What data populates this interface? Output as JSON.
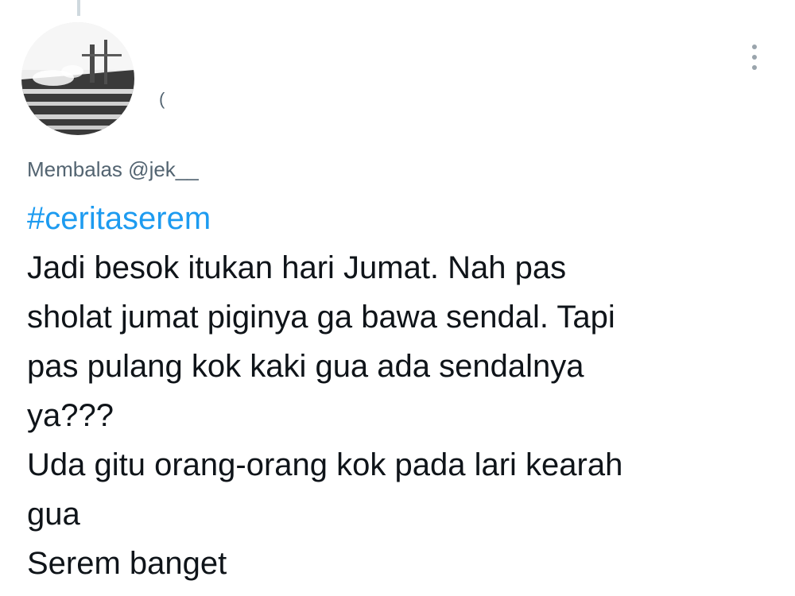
{
  "tweet": {
    "author_name_partial": "(",
    "reply_prefix": "Membalas",
    "reply_handle": "@jek__",
    "hashtag": "#ceritaserem",
    "body_lines": [
      "Jadi besok itukan hari Jumat. Nah pas",
      "sholat jumat piginya ga bawa sendal. Tapi",
      "pas pulang kok kaki gua ada sendalnya",
      "ya???",
      "Uda gitu orang-orang kok pada lari kearah",
      "gua",
      "Serem banget"
    ]
  },
  "icons": {
    "more": "more-vertical-icon",
    "avatar": "profile-avatar-image"
  },
  "colors": {
    "hashtag": "#1d9bf0",
    "secondary_text": "#536471",
    "primary_text": "#0f1419"
  }
}
